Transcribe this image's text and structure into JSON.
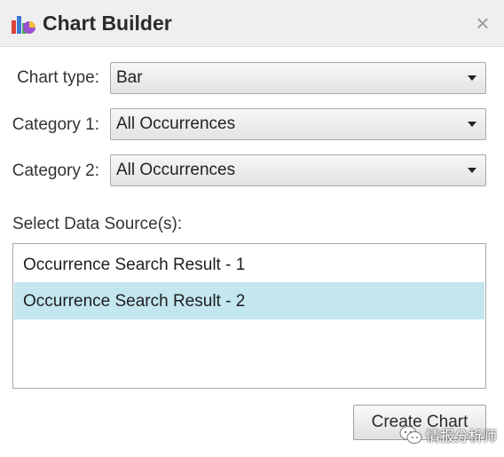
{
  "dialog": {
    "title": "Chart Builder",
    "close_label": "×",
    "icons": {
      "title": "chart-builder-icon",
      "close": "close-icon"
    }
  },
  "fields": {
    "chart_type": {
      "label": "Chart type:",
      "value": "Bar"
    },
    "category1": {
      "label": "Category 1:",
      "value": "All Occurrences"
    },
    "category2": {
      "label": "Category 2:",
      "value": "All Occurrences"
    }
  },
  "data_sources": {
    "label": "Select Data Source(s):",
    "items": [
      {
        "label": "Occurrence Search Result - 1",
        "selected": false
      },
      {
        "label": "Occurrence Search Result - 2",
        "selected": true
      }
    ]
  },
  "actions": {
    "create_label": "Create Chart"
  },
  "watermark": {
    "text": "情报分析师"
  },
  "colors": {
    "selection": "#c3e6ef",
    "titlebar": "#efefef"
  }
}
